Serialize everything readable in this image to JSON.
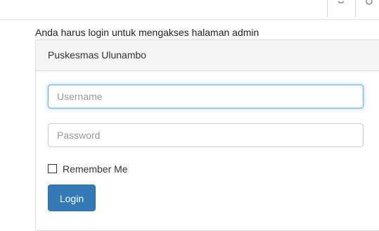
{
  "browser_toolbar": {
    "reload_icon": "reload-icon",
    "search_icon": "search-icon"
  },
  "notice": "Anda harus login untuk mengakses halaman admin",
  "panel": {
    "title": "Puskesmas Ulunambo"
  },
  "form": {
    "username_placeholder": "Username",
    "username_value": "",
    "password_placeholder": "Password",
    "password_value": "",
    "remember_label": "Remember Me",
    "remember_checked": false,
    "login_label": "Login"
  },
  "colors": {
    "primary": "#337ab7",
    "focus": "#66afe9",
    "panel_heading": "#f5f5f5"
  }
}
